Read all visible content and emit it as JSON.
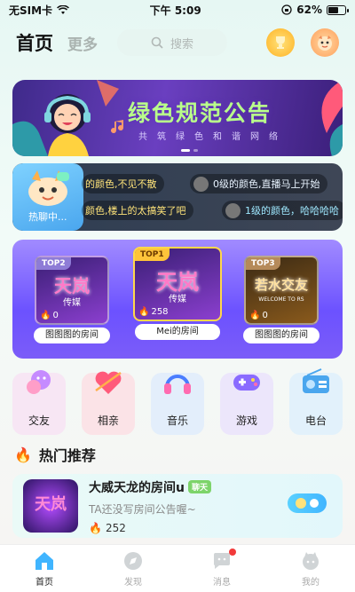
{
  "status_bar": {
    "carrier": "无SIM卡",
    "time": "下午 5:09",
    "battery": "62%",
    "battery_level": 0.62
  },
  "header": {
    "tab_home": "首页",
    "tab_more": "更多",
    "search_placeholder": "搜索"
  },
  "banner": {
    "title": "绿色规范公告",
    "subtitle": "共筑绿色和谐网络",
    "colors": {
      "title": "#b9ff8a"
    }
  },
  "chat": {
    "hot_label": "热聊中...",
    "messages": [
      {
        "text": "的颜色,不见不散"
      },
      {
        "text": "0级的颜色,直播马上开始"
      },
      {
        "text": "颜色,楼上的太搞笑了吧"
      },
      {
        "text": "1级的颜色，哈哈哈哈"
      }
    ]
  },
  "ranking": [
    {
      "tag": "TOP2",
      "art": "天岚",
      "art_sub": "传媒",
      "count": "0",
      "room": "图图图的房间"
    },
    {
      "tag": "TOP1",
      "art": "天岚",
      "art_sub": "传媒",
      "count": "258",
      "room": "Mei的房间"
    },
    {
      "tag": "TOP3",
      "art": "若水交友",
      "art_sub": "WELCOME TO RS",
      "count": "0",
      "room": "图图图的房间"
    }
  ],
  "categories": [
    {
      "label": "交友",
      "icon": "bubble-icon",
      "bg": "#f7e6f4"
    },
    {
      "label": "相亲",
      "icon": "heart-icon",
      "bg": "#fbe3e7"
    },
    {
      "label": "音乐",
      "icon": "headphones-icon",
      "bg": "#e3eefb"
    },
    {
      "label": "游戏",
      "icon": "gamepad-icon",
      "bg": "#ece6fb"
    },
    {
      "label": "电台",
      "icon": "radio-icon",
      "bg": "#e2f1fb"
    }
  ],
  "section": {
    "title": "热门推荐"
  },
  "hot_room": {
    "title": "大威天龙的房间u",
    "badge": "聊天",
    "desc": "TA还没写房间公告喔~",
    "count": "252",
    "cover_text": "天岚"
  },
  "tabbar": [
    {
      "label": "首页",
      "icon": "home-icon",
      "active": true
    },
    {
      "label": "发现",
      "icon": "discover-icon"
    },
    {
      "label": "消息",
      "icon": "message-icon"
    },
    {
      "label": "我的",
      "icon": "profile-icon"
    }
  ]
}
